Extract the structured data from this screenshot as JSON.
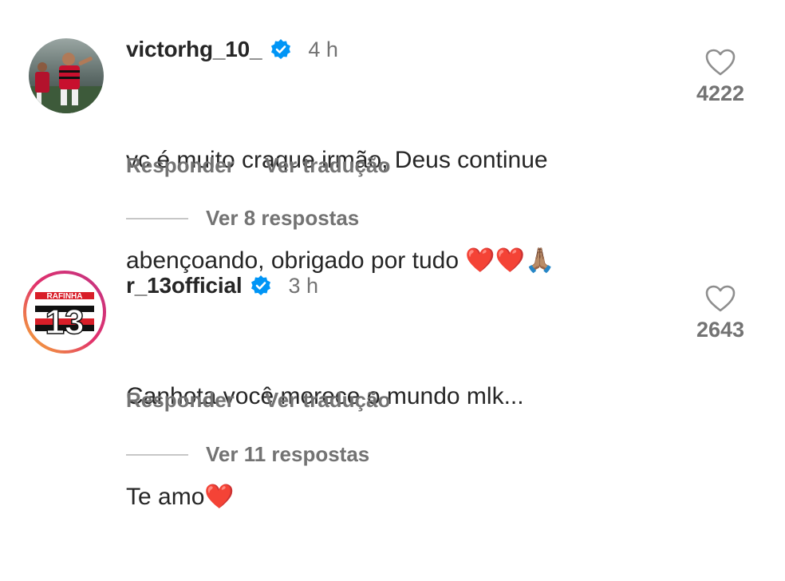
{
  "comments": [
    {
      "username": "victorhg_10_",
      "verified": true,
      "time": "4 h",
      "text_line1": "vc é muito craque irmão, Deus continue",
      "text_line2": "abençoando, obrigado por tudo ❤️❤️🙏🏽",
      "reply_label": "Responder",
      "translate_label": "Ver tradução",
      "view_replies": "Ver 8 respostas",
      "likes": "4222",
      "avatar_icon": "soccer-player-photo"
    },
    {
      "username": "r_13official",
      "verified": true,
      "time": "3 h",
      "text_line1": "Canhota você merece o mundo mlk...",
      "text_line2": "Te amo❤️",
      "reply_label": "Responder",
      "translate_label": "Ver tradução",
      "view_replies": "Ver 11 respostas",
      "likes": "2643",
      "avatar_icon": "rafinha-13-logo",
      "avatar_text": "RAFINHA",
      "avatar_number": "13"
    }
  ],
  "colors": {
    "verified_blue": "#0095f6",
    "secondary_text": "#737373",
    "primary_text": "#262626"
  }
}
